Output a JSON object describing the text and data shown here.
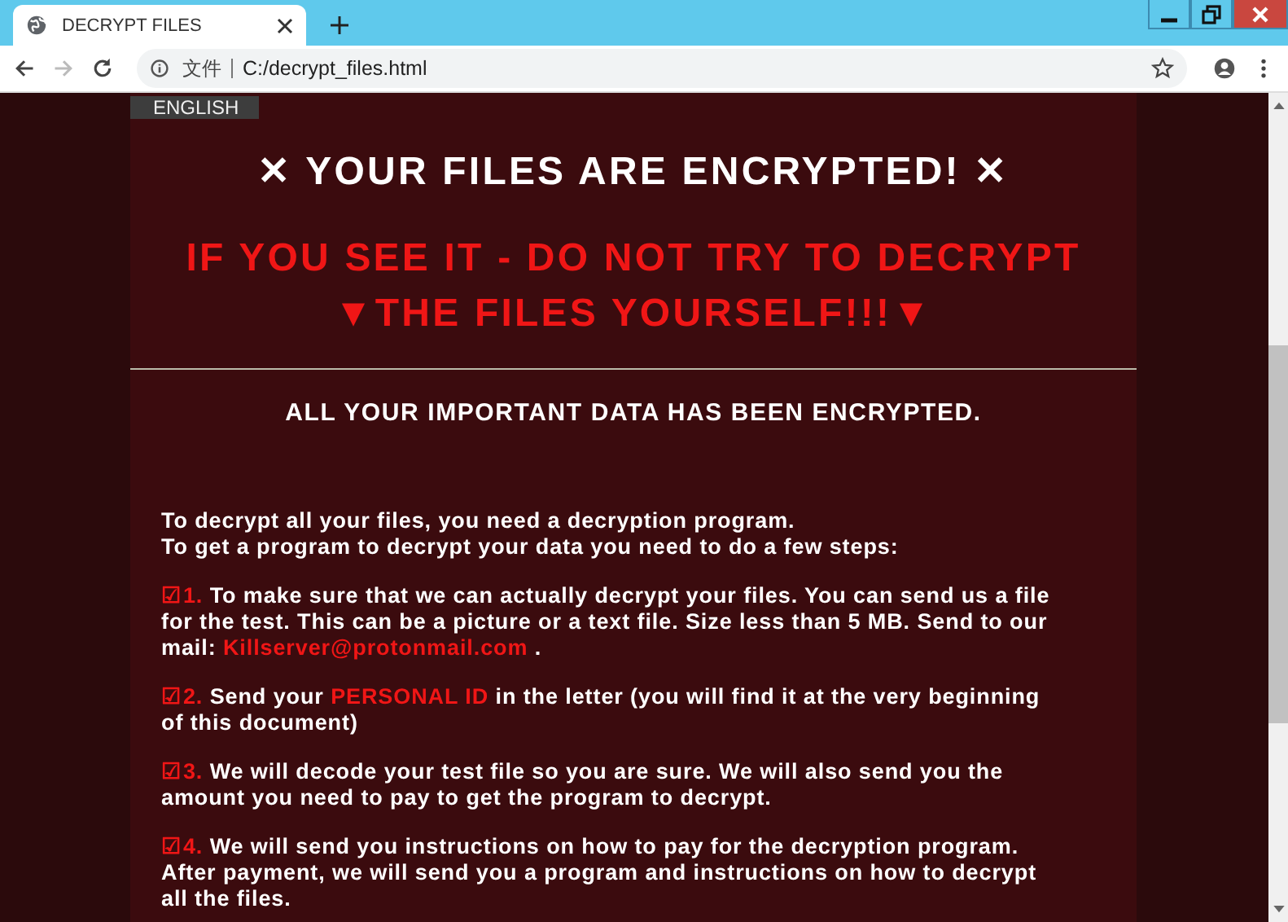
{
  "browser": {
    "tab_title": "DECRYPT FILES",
    "address_prefix": "文件",
    "address": "C:/decrypt_files.html"
  },
  "page": {
    "language_tab": "ENGLISH",
    "title": "✕ YOUR FILES ARE ENCRYPTED! ✕",
    "warning_lines": [
      "IF YOU SEE IT - DO NOT TRY TO DECRYPT",
      "▼THE FILES YOURSELF!!!▼"
    ],
    "subtitle": "ALL YOUR IMPORTANT DATA HAS BEEN ENCRYPTED.",
    "intro": [
      "To decrypt all your files, you need a decryption program.",
      "To get a program to decrypt your data you need to do a few steps:"
    ],
    "steps": [
      {
        "number": "☑1.",
        "parts": [
          {
            "kind": "plain",
            "text": "To make sure that we can actually decrypt your files. You can send us a file for the test. This can be a picture or a text file. Size less than 5 MB. Send to our mail:"
          },
          {
            "kind": "email",
            "text": "Killserver@protonmail.com"
          },
          {
            "kind": "plain",
            "text": "."
          }
        ]
      },
      {
        "number": "☑2.",
        "parts": [
          {
            "kind": "plain",
            "text": "Send your"
          },
          {
            "kind": "highlight",
            "text": "PERSONAL ID"
          },
          {
            "kind": "plain",
            "text": "in the letter (you will find it at the very beginning of this document)"
          }
        ]
      },
      {
        "number": "☑3.",
        "parts": [
          {
            "kind": "plain",
            "text": "We will decode your test file so you are sure. We will also send you the amount you need to pay to get the program to decrypt."
          }
        ]
      },
      {
        "number": "☑4.",
        "parts": [
          {
            "kind": "plain",
            "text": "We will send you instructions on how to pay for the decryption program. After payment, we will send you a program and instructions on how to decrypt all the files."
          }
        ]
      }
    ]
  }
}
